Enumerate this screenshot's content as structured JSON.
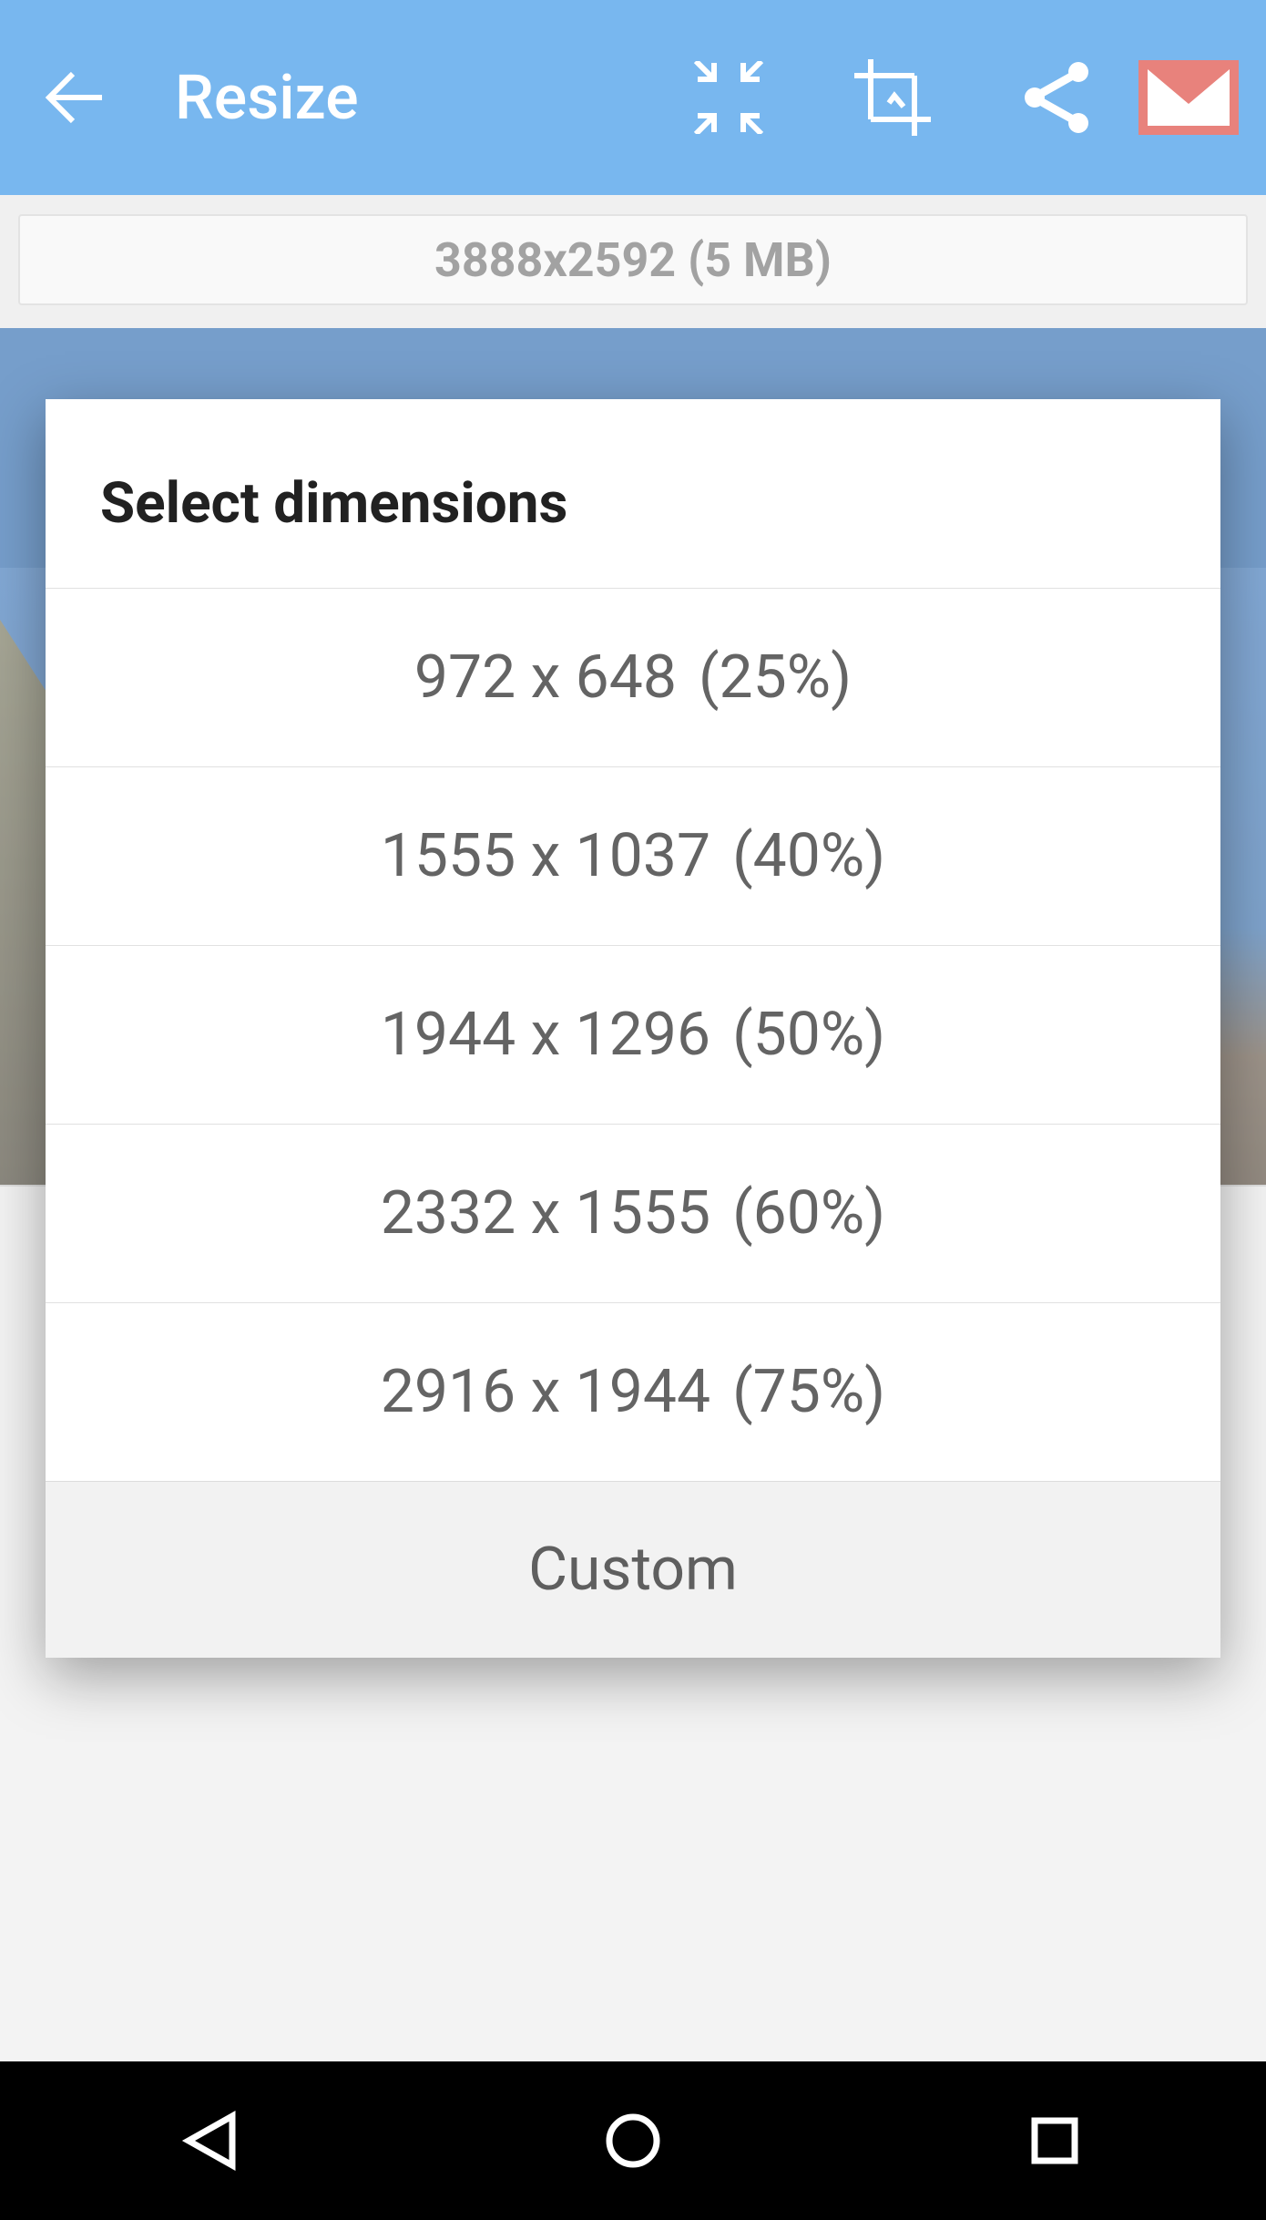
{
  "appbar": {
    "title": "Resize"
  },
  "info": {
    "text": "3888x2592 (5 MB)"
  },
  "dialog": {
    "title": "Select dimensions",
    "options": [
      {
        "dim": "972 x 648",
        "pct": "(25%)"
      },
      {
        "dim": "1555 x 1037",
        "pct": "(40%)"
      },
      {
        "dim": "1944 x 1296",
        "pct": "(50%)"
      },
      {
        "dim": "2332 x 1555",
        "pct": "(60%)"
      },
      {
        "dim": "2916 x 1944",
        "pct": "(75%)"
      }
    ],
    "custom_label": "Custom"
  }
}
